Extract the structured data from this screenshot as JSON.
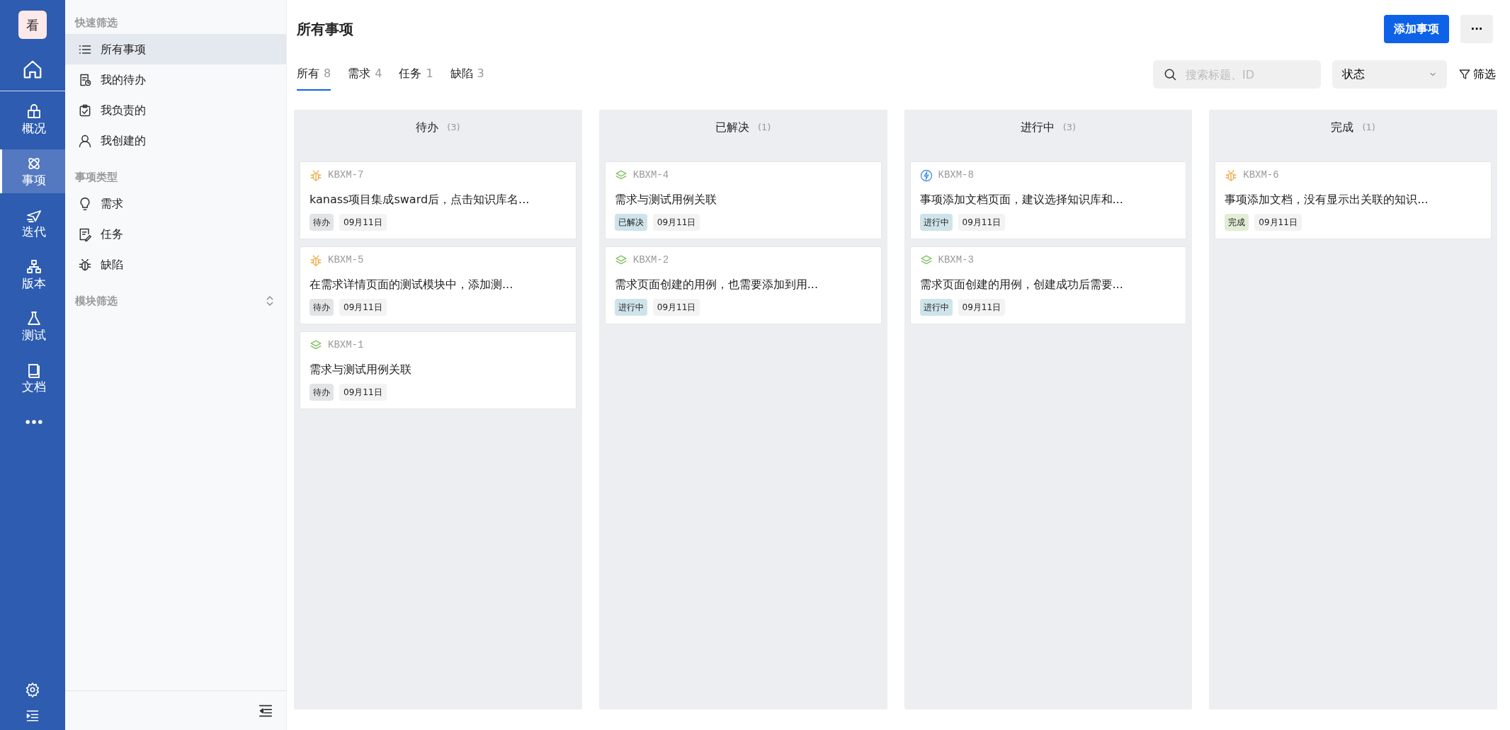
{
  "rail": {
    "logo": "看",
    "items": [
      {
        "kind": "home",
        "selected": false
      },
      {
        "kind": "overview",
        "label": "概况",
        "selected": false
      },
      {
        "kind": "issues",
        "label": "事项",
        "selected": true
      },
      {
        "kind": "sprint",
        "label": "迭代",
        "selected": false
      },
      {
        "kind": "version",
        "label": "版本",
        "selected": false
      },
      {
        "kind": "test",
        "label": "测试",
        "selected": false
      },
      {
        "kind": "docs",
        "label": "文档",
        "selected": false
      },
      {
        "kind": "more",
        "selected": false
      }
    ]
  },
  "sidebar": {
    "sections": [
      {
        "heading": "快速筛选",
        "items": [
          {
            "kind": "list",
            "label": "所有事项",
            "selected": true
          },
          {
            "kind": "todo",
            "label": "我的待办",
            "selected": false
          },
          {
            "kind": "owned",
            "label": "我负责的",
            "selected": false
          },
          {
            "kind": "user",
            "label": "我创建的",
            "selected": false
          }
        ]
      },
      {
        "heading": "事项类型",
        "items": [
          {
            "kind": "bulb",
            "label": "需求",
            "selected": false
          },
          {
            "kind": "task",
            "label": "任务",
            "selected": false
          },
          {
            "kind": "bug",
            "label": "缺陷",
            "selected": false
          }
        ]
      },
      {
        "heading": "模块筛选"
      }
    ]
  },
  "page": {
    "title": "所有事项",
    "add_button": "添加事项",
    "more_button": "···",
    "tabs": [
      {
        "label": "所有",
        "count": "8",
        "selected": true
      },
      {
        "label": "需求",
        "count": "4",
        "selected": false
      },
      {
        "label": "任务",
        "count": "1",
        "selected": false
      },
      {
        "label": "缺陷",
        "count": "3",
        "selected": false
      }
    ],
    "search": {
      "placeholder": "搜索标题、ID"
    },
    "status_select": "状态",
    "filter": "筛选"
  },
  "board": {
    "columns": [
      {
        "title": "待办",
        "count": "(3)",
        "cards": [
          {
            "kind": "bug",
            "id": "KBXM-7",
            "title": "kanass项目集成sward后，点击知识库名...",
            "status": "待办",
            "color": "#e3e4e6",
            "date": "09月11日"
          },
          {
            "kind": "bug",
            "id": "KBXM-5",
            "title": "在需求详情页面的测试模块中，添加测...",
            "status": "待办",
            "color": "#e3e4e6",
            "date": "09月11日"
          },
          {
            "kind": "requirement",
            "id": "KBXM-1",
            "title": "需求与测试用例关联",
            "status": "待办",
            "color": "#e3e4e6",
            "date": "09月11日"
          }
        ]
      },
      {
        "title": "已解决",
        "count": "(1)",
        "cards": [
          {
            "kind": "requirement",
            "id": "KBXM-4",
            "title": "需求与测试用例关联",
            "status": "已解决",
            "color": "#cfe4ea",
            "date": "09月11日"
          },
          {
            "kind": "requirement",
            "id": "KBXM-2",
            "title": "需求页面创建的用例，也需要添加到用...",
            "status": "进行中",
            "color": "#cfe4ea",
            "date": "09月11日"
          }
        ]
      },
      {
        "title": "进行中",
        "count": "(3)",
        "cards": [
          {
            "kind": "task",
            "id": "KBXM-8",
            "title": "事项添加文档页面，建议选择知识库和...",
            "status": "进行中",
            "color": "#cfe4ea",
            "date": "09月11日"
          },
          {
            "kind": "requirement",
            "id": "KBXM-3",
            "title": "需求页面创建的用例，创建成功后需要...",
            "status": "进行中",
            "color": "#cfe4ea",
            "date": "09月11日"
          }
        ]
      },
      {
        "title": "完成",
        "count": "(1)",
        "cards": [
          {
            "kind": "bug",
            "id": "KBXM-6",
            "title": "事项添加文档，没有显示出关联的知识...",
            "status": "完成",
            "color": "#e3edd5",
            "date": "09月11日"
          }
        ]
      }
    ]
  }
}
